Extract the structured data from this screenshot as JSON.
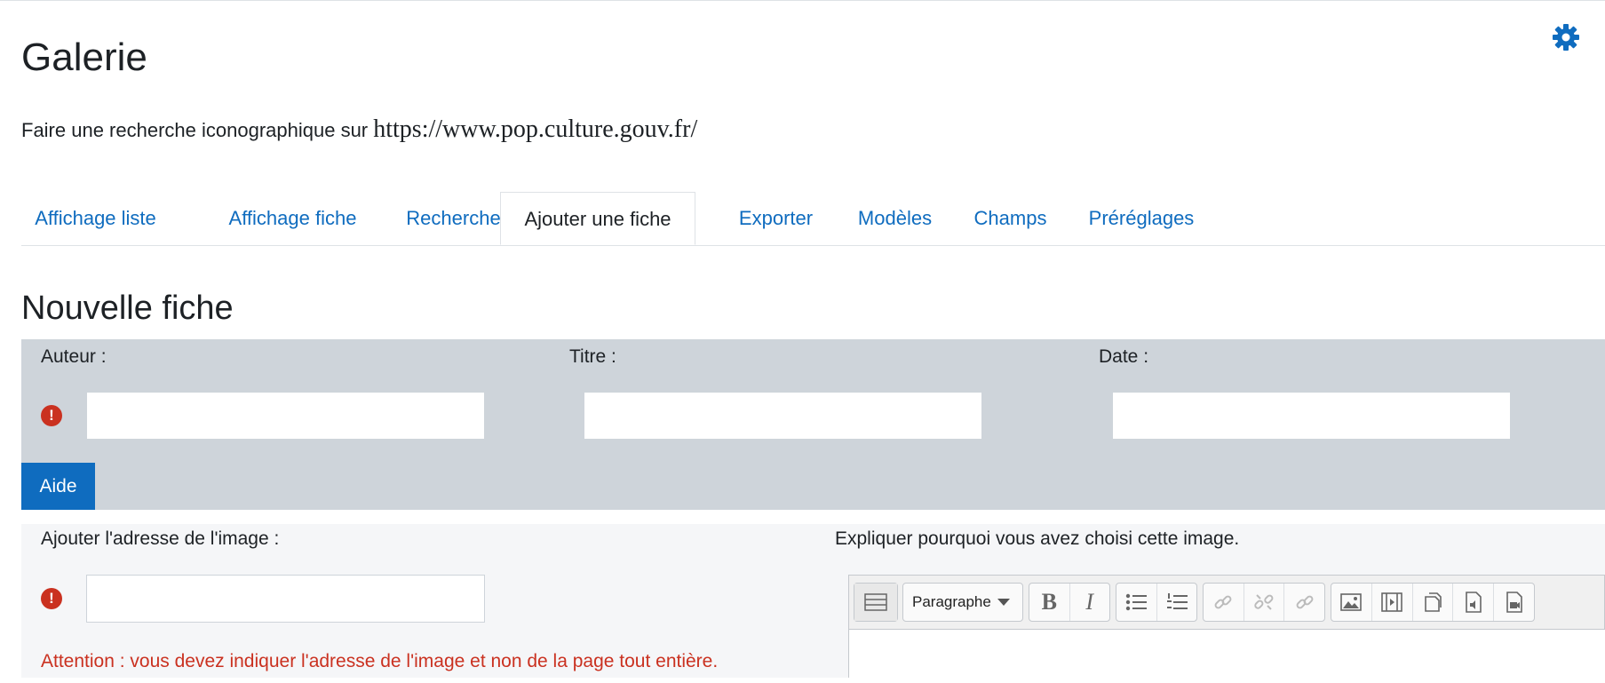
{
  "header": {
    "title": "Galerie",
    "intro_text": "Faire une recherche iconographique sur ",
    "intro_link": "https://www.pop.culture.gouv.fr/"
  },
  "tabs": [
    {
      "label": "Affichage liste"
    },
    {
      "label": "Affichage fiche"
    },
    {
      "label": "Recherche"
    },
    {
      "label": "Ajouter une fiche",
      "active": true
    },
    {
      "label": "Exporter"
    },
    {
      "label": "Modèles"
    },
    {
      "label": "Champs"
    },
    {
      "label": "Préréglages"
    }
  ],
  "form": {
    "title": "Nouvelle fiche",
    "fields": {
      "auteur_label": "Auteur :",
      "titre_label": "Titre :",
      "date_label": "Date :",
      "auteur_value": "",
      "titre_value": "",
      "date_value": ""
    },
    "aide_label": "Aide",
    "image_label": "Ajouter l'adresse de l'image :",
    "image_value": "",
    "explain_label": "Expliquer pourquoi vous avez choisi cette image.",
    "warning": "Attention : vous devez indiquer l'adresse de l'image et non de la page tout entière.",
    "required_mark": "!"
  },
  "editor": {
    "format_select": "Paragraphe",
    "buttons": [
      "toolbar-toggle-icon",
      "bold-icon",
      "italic-icon",
      "unordered-list-icon",
      "ordered-list-icon",
      "link-icon",
      "unlink-icon",
      "anchor-link-icon",
      "image-icon",
      "media-icon",
      "manage-files-icon",
      "audio-record-icon",
      "video-record-icon"
    ]
  },
  "colors": {
    "accent": "#0f6cbf",
    "error": "#ca3120",
    "band_gray": "#ced4da",
    "band_light": "#f5f6f8"
  }
}
